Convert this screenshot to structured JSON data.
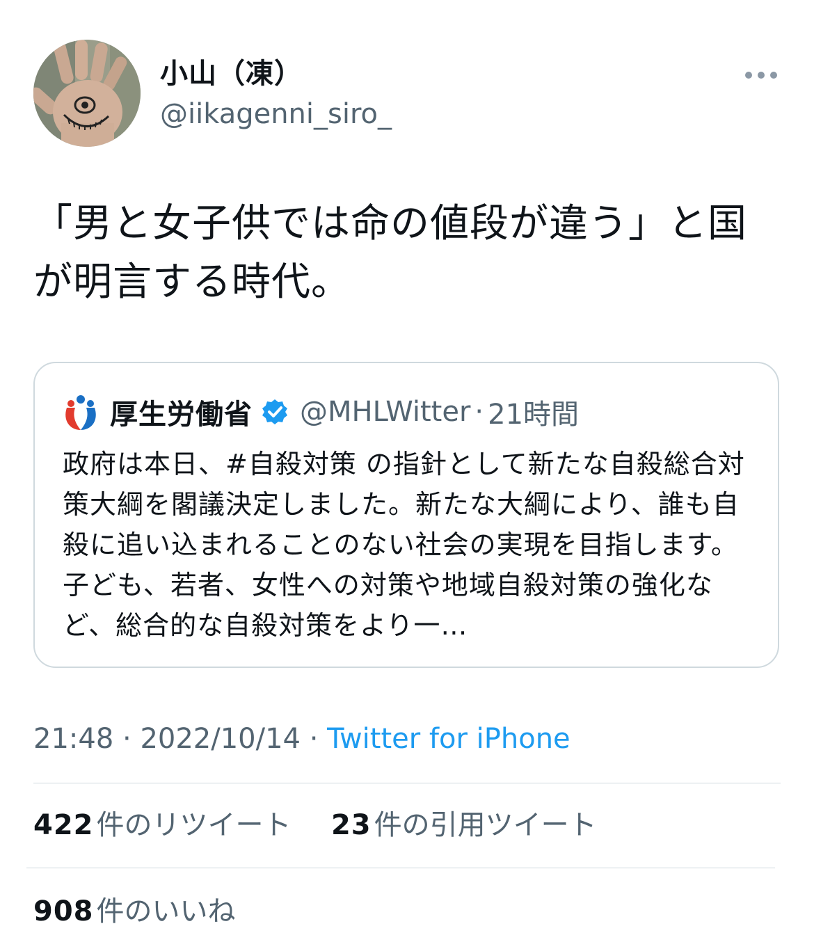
{
  "author": {
    "display_name": "小山（凍）",
    "handle": "@iikagenni_siro_",
    "avatar_icon": "hand-with-eye-avatar"
  },
  "more_icon": "more-horizontal-icon",
  "tweet": {
    "text": "「男と女子供では命の値段が違う」と国が明言する時代。"
  },
  "quoted_tweet": {
    "display_name": "厚生労働省",
    "verified_icon": "verified-badge-icon",
    "handle": "@MHLWitter",
    "separator": "·",
    "time": "21時間",
    "text": "政府は本日、#自殺対策 の指針として新たな自殺総合対策大綱を閣議決定しました。新たな大綱により、誰も自殺に追い込まれることのない社会の実現を目指します。子ども、若者、女性への対策や地域自殺対策の強化など、総合的な自殺対策をより一…"
  },
  "meta": {
    "time": "21:48",
    "sep1": "·",
    "date": "2022/10/14",
    "sep2": "·",
    "source": "Twitter for iPhone"
  },
  "stats": {
    "retweets_count": "422",
    "retweets_label": "件のリツイート",
    "quotes_count": "23",
    "quotes_label": "件の引用ツイート",
    "likes_count": "908",
    "likes_label": "件のいいね"
  },
  "colors": {
    "text": "#0f1419",
    "secondary": "#536471",
    "link": "#1d9bf0",
    "border": "#cfd9de",
    "verified": "#1d9bf0"
  }
}
